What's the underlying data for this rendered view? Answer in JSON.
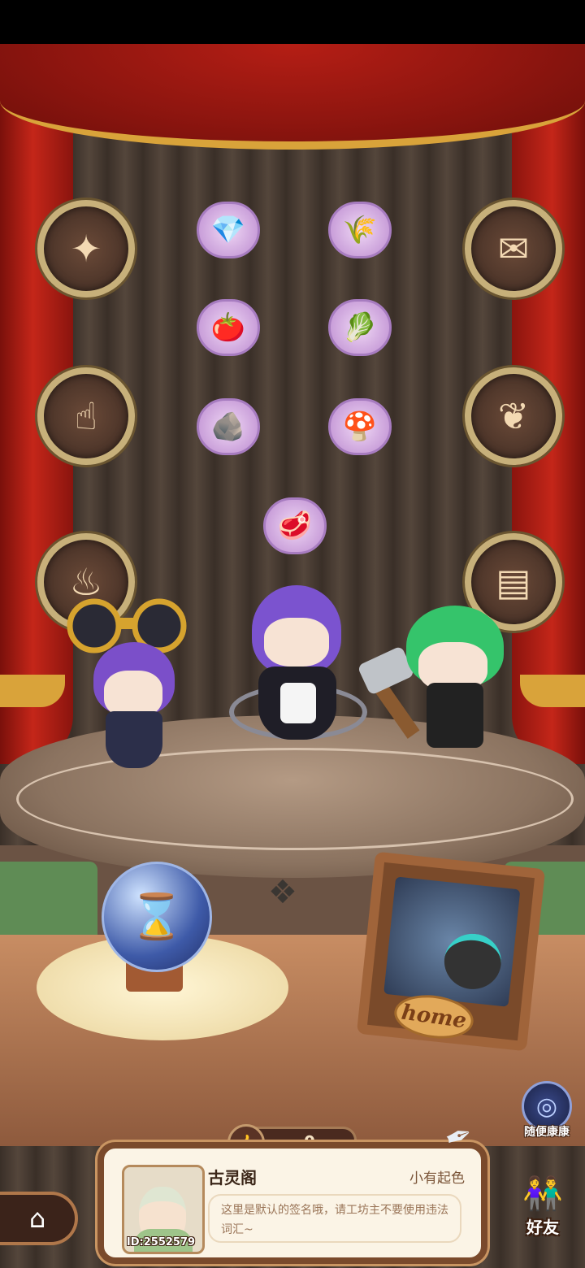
{
  "stage": {
    "achievement_medals": [
      {
        "icon": "fairy-icon"
      },
      {
        "icon": "scroll-icon"
      },
      {
        "icon": "thumbs-up-icon"
      },
      {
        "icon": "sprout-icon"
      },
      {
        "icon": "cauldron-icon"
      },
      {
        "icon": "book-icon"
      }
    ],
    "material_bubbles": [
      {
        "icon": "gem-icon",
        "glyph": "💎"
      },
      {
        "icon": "wheat-icon",
        "glyph": "🌾"
      },
      {
        "icon": "tomato-icon",
        "glyph": "🍅"
      },
      {
        "icon": "leek-icon",
        "glyph": "🥬"
      },
      {
        "icon": "ore-icon",
        "glyph": "🪨"
      },
      {
        "icon": "mushroom-icon",
        "glyph": "🍄"
      },
      {
        "icon": "meat-icon",
        "glyph": "🥩"
      }
    ],
    "characters": [
      {
        "name": "binocular-girl"
      },
      {
        "name": "maid-girl"
      },
      {
        "name": "hammer-girl"
      }
    ]
  },
  "crystal_ball": {
    "icon": "hourglass-icon",
    "glyph": "⌛"
  },
  "home_frame": {
    "label": "home"
  },
  "random_visit": {
    "label": "随便康康",
    "icon": "portal-icon"
  },
  "likes": {
    "count": "0",
    "icon": "thumbs-up-icon"
  },
  "profile": {
    "shop_name": "古灵阁",
    "rank": "小有起色",
    "signature": "这里是默认的签名哦，请工坊主不要使用违法词汇~",
    "user_id": "ID:2552579"
  },
  "nav": {
    "home_icon": "house-icon",
    "friends_label": "好友"
  }
}
